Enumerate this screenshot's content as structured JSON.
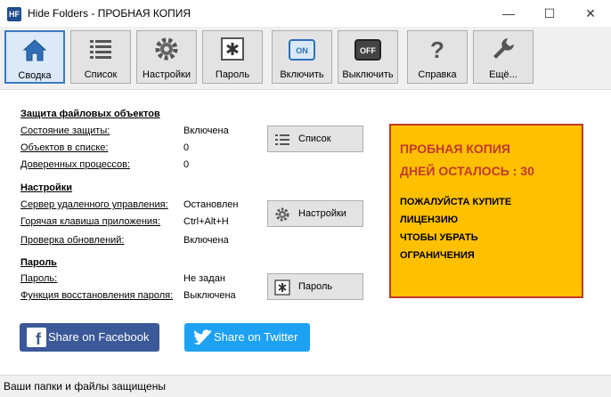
{
  "window": {
    "title": "Hide Folders - ПРОБНАЯ КОПИЯ",
    "app_icon_text": "HF",
    "minimize_glyph": "—",
    "maximize_glyph": "☐",
    "close_glyph": "✕"
  },
  "toolbar": {
    "buttons": [
      {
        "label": "Сводка",
        "icon": "home-icon",
        "active": true
      },
      {
        "label": "Список",
        "icon": "list-icon"
      },
      {
        "label": "Настройки",
        "icon": "gear-icon"
      },
      {
        "label": "Пароль",
        "icon": "password-icon"
      },
      {
        "label": "Включить",
        "icon": "on-icon",
        "icon_text": "ON"
      },
      {
        "label": "Выключить",
        "icon": "off-icon",
        "icon_text": "OFF"
      },
      {
        "label": "Справка",
        "icon": "help-icon",
        "icon_text": "?"
      },
      {
        "label": "Ещё...",
        "icon": "wrench-icon"
      }
    ]
  },
  "sections": {
    "protection": {
      "heading": "Защита файловых объектов",
      "rows": [
        {
          "label": "Состояние защиты:",
          "value": "Включена"
        },
        {
          "label": "Объектов в списке:",
          "value": "0"
        },
        {
          "label": "Доверенных процессов:",
          "value": "0"
        }
      ],
      "button": "Список"
    },
    "settings": {
      "heading": "Настройки",
      "rows": [
        {
          "label": "Сервер удаленного управления:",
          "value": "Остановлен"
        },
        {
          "label": "Горячая клавиша приложения:",
          "value": "Ctrl+Alt+H"
        },
        {
          "label": "Проверка обновлений:",
          "value": "Включена"
        }
      ],
      "button": "Настройки"
    },
    "password": {
      "heading": "Пароль",
      "rows": [
        {
          "label": "Пароль:",
          "value": "Не задан"
        },
        {
          "label": "Функция восстановления пароля:",
          "value": "Выключена"
        }
      ],
      "button": "Пароль"
    }
  },
  "trial": {
    "line1": "ПРОБНАЯ КОПИЯ",
    "line2": "ДНЕЙ ОСТАЛОСЬ : 30",
    "message": [
      "ПОЖАЛУЙСТА КУПИТЕ",
      "ЛИЦЕНЗИЮ",
      "ЧТОБЫ УБРАТЬ",
      "ОГРАНИЧЕНИЯ"
    ]
  },
  "social": {
    "facebook": {
      "label": "Share on Facebook",
      "glyph": "f",
      "color": "#3b5998"
    },
    "twitter": {
      "label": "Share on Twitter",
      "color": "#1da1f2"
    }
  },
  "status": {
    "text": "Ваши папки и файлы защищены"
  },
  "colors": {
    "accent": "#3b7ac6",
    "trial_bg": "#ffc000",
    "trial_text": "#c0392b"
  }
}
